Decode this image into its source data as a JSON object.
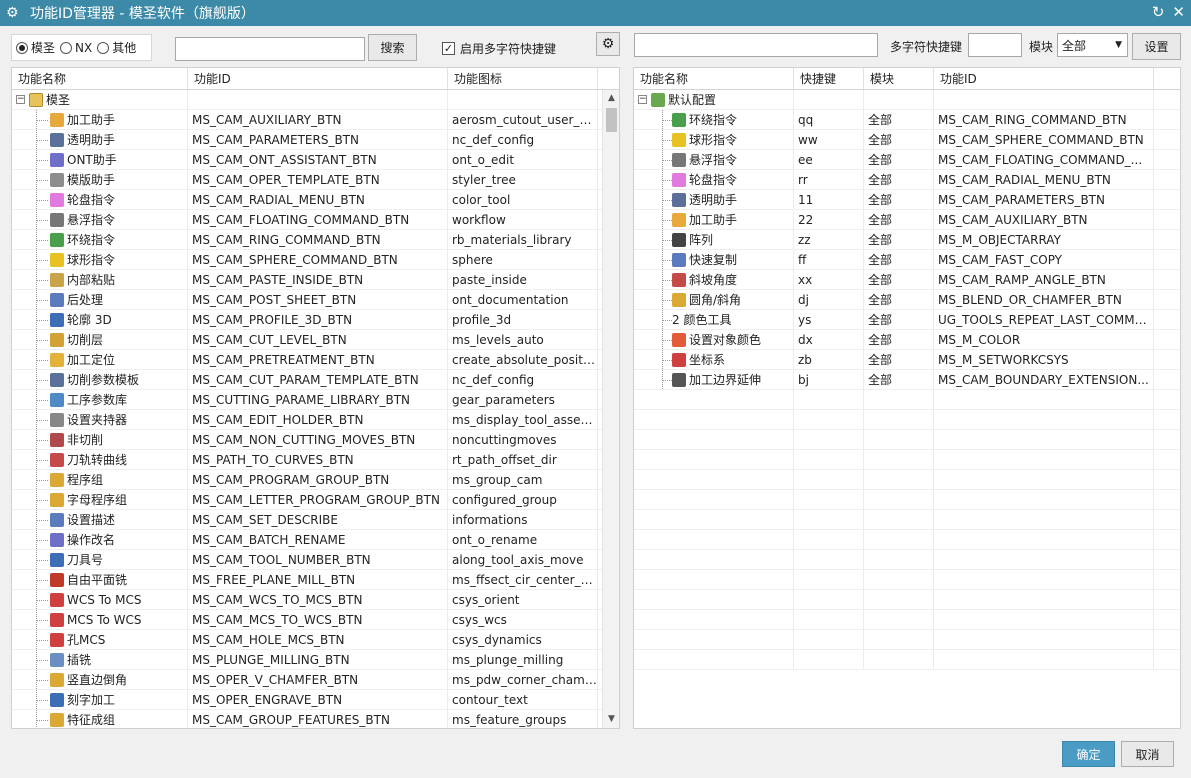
{
  "window": {
    "title": "功能ID管理器 - 模圣软件（旗舰版）"
  },
  "toolbar": {
    "radios": [
      {
        "label": "模圣",
        "checked": true
      },
      {
        "label": "NX",
        "checked": false
      },
      {
        "label": "其他",
        "checked": false
      }
    ],
    "search_value": "",
    "search_label": "搜索",
    "multi_shortcut_label": "启用多字符快捷键",
    "multi_shortcut_checked": true,
    "right_search_value": "",
    "shortcut_field_label": "多字符快捷键",
    "shortcut_value": "",
    "module_label": "模块",
    "module_selected": "全部",
    "set_label": "设置"
  },
  "left_table": {
    "columns": [
      "功能名称",
      "功能ID",
      "功能图标"
    ],
    "root": "模圣",
    "rows": [
      {
        "name": "加工助手",
        "id": "MS_CAM_AUXILIARY_BTN",
        "icon": "aerosm_cutout_user_d...",
        "color": "#e7a93b"
      },
      {
        "name": "透明助手",
        "id": "MS_CAM_PARAMETERS_BTN",
        "icon": "nc_def_config",
        "color": "#5a6f99"
      },
      {
        "name": "ONT助手",
        "id": "MS_CAM_ONT_ASSISTANT_BTN",
        "icon": "ont_o_edit",
        "color": "#6f6fc8"
      },
      {
        "name": "模版助手",
        "id": "MS_CAM_OPER_TEMPLATE_BTN",
        "icon": "styler_tree",
        "color": "#8c8c8c"
      },
      {
        "name": "轮盘指令",
        "id": "MS_CAM_RADIAL_MENU_BTN",
        "icon": "color_tool",
        "color": "#e07adf"
      },
      {
        "name": "悬浮指令",
        "id": "MS_CAM_FLOATING_COMMAND_BTN",
        "icon": "workflow",
        "color": "#777777"
      },
      {
        "name": "环绕指令",
        "id": "MS_CAM_RING_COMMAND_BTN",
        "icon": "rb_materials_library",
        "color": "#4aa04a"
      },
      {
        "name": "球形指令",
        "id": "MS_CAM_SPHERE_COMMAND_BTN",
        "icon": "sphere",
        "color": "#e8c224"
      },
      {
        "name": "内部粘贴",
        "id": "MS_CAM_PASTE_INSIDE_BTN",
        "icon": "paste_inside",
        "color": "#c9a24a"
      },
      {
        "name": "后处理",
        "id": "MS_CAM_POST_SHEET_BTN",
        "icon": "ont_documentation",
        "color": "#5b7bbd"
      },
      {
        "name": "轮廓 3D",
        "id": "MS_CAM_PROFILE_3D_BTN",
        "icon": "profile_3d",
        "color": "#3d6db5"
      },
      {
        "name": "切削层",
        "id": "MS_CAM_CUT_LEVEL_BTN",
        "icon": "ms_levels_auto",
        "color": "#d2a234"
      },
      {
        "name": "加工定位",
        "id": "MS_CAM_PRETREATMENT_BTN",
        "icon": "create_absolute_positi...",
        "color": "#e3b23a"
      },
      {
        "name": "切削参数模板",
        "id": "MS_CAM_CUT_PARAM_TEMPLATE_BTN",
        "icon": "nc_def_config",
        "color": "#5a6f99"
      },
      {
        "name": "工序参数库",
        "id": "MS_CUTTING_PARAME_LIBRARY_BTN",
        "icon": "gear_parameters",
        "color": "#4f8ac7"
      },
      {
        "name": "设置夹持器",
        "id": "MS_CAM_EDIT_HOLDER_BTN",
        "icon": "ms_display_tool_assem...",
        "color": "#888888"
      },
      {
        "name": "非切削",
        "id": "MS_CAM_NON_CUTTING_MOVES_BTN",
        "icon": "noncuttingmoves",
        "color": "#b04a4a"
      },
      {
        "name": "刀轨转曲线",
        "id": "MS_PATH_TO_CURVES_BTN",
        "icon": "rt_path_offset_dir",
        "color": "#c74a4a"
      },
      {
        "name": "程序组",
        "id": "MS_CAM_PROGRAM_GROUP_BTN",
        "icon": "ms_group_cam",
        "color": "#d9a934"
      },
      {
        "name": "字母程序组",
        "id": "MS_CAM_LETTER_PROGRAM_GROUP_BTN",
        "icon": "configured_group",
        "color": "#d9a934"
      },
      {
        "name": "设置描述",
        "id": "MS_CAM_SET_DESCRIBE",
        "icon": "informations",
        "color": "#5b7bbd"
      },
      {
        "name": "操作改名",
        "id": "MS_CAM_BATCH_RENAME",
        "icon": "ont_o_rename",
        "color": "#6f6fc8"
      },
      {
        "name": "刀具号",
        "id": "MS_CAM_TOOL_NUMBER_BTN",
        "icon": "along_tool_axis_move",
        "color": "#3d6db5"
      },
      {
        "name": "自由平面铣",
        "id": "MS_FREE_PLANE_MILL_BTN",
        "icon": "ms_ffsect_cir_center_p...",
        "color": "#c0392b"
      },
      {
        "name": "WCS To MCS",
        "id": "MS_CAM_WCS_TO_MCS_BTN",
        "icon": "csys_orient",
        "color": "#d04040"
      },
      {
        "name": "MCS To WCS",
        "id": "MS_CAM_MCS_TO_WCS_BTN",
        "icon": "csys_wcs",
        "color": "#d04040"
      },
      {
        "name": "孔MCS",
        "id": "MS_CAM_HOLE_MCS_BTN",
        "icon": "csys_dynamics",
        "color": "#d04040"
      },
      {
        "name": "插铣",
        "id": "MS_PLUNGE_MILLING_BTN",
        "icon": "ms_plunge_milling",
        "color": "#6a8fc0"
      },
      {
        "name": "竖直边倒角",
        "id": "MS_OPER_V_CHAMFER_BTN",
        "icon": "ms_pdw_corner_chamfer",
        "color": "#d9a934"
      },
      {
        "name": "刻字加工",
        "id": "MS_OPER_ENGRAVE_BTN",
        "icon": "contour_text",
        "color": "#3d6db5"
      },
      {
        "name": "特征成组",
        "id": "MS_CAM_GROUP_FEATURES_BTN",
        "icon": "ms_feature_groups",
        "color": "#d9a934"
      }
    ]
  },
  "right_table": {
    "columns": [
      "功能名称",
      "快捷键",
      "模块",
      "功能ID"
    ],
    "root": "默认配置",
    "rows": [
      {
        "name": "环绕指令",
        "key": "qq",
        "module": "全部",
        "id": "MS_CAM_RING_COMMAND_BTN",
        "color": "#4aa04a"
      },
      {
        "name": "球形指令",
        "key": "ww",
        "module": "全部",
        "id": "MS_CAM_SPHERE_COMMAND_BTN",
        "color": "#e8c224"
      },
      {
        "name": "悬浮指令",
        "key": "ee",
        "module": "全部",
        "id": "MS_CAM_FLOATING_COMMAND_...",
        "color": "#777777"
      },
      {
        "name": "轮盘指令",
        "key": "rr",
        "module": "全部",
        "id": "MS_CAM_RADIAL_MENU_BTN",
        "color": "#e07adf"
      },
      {
        "name": "透明助手",
        "key": "11",
        "module": "全部",
        "id": "MS_CAM_PARAMETERS_BTN",
        "color": "#5a6f99"
      },
      {
        "name": "加工助手",
        "key": "22",
        "module": "全部",
        "id": "MS_CAM_AUXILIARY_BTN",
        "color": "#e7a93b"
      },
      {
        "name": "阵列",
        "key": "zz",
        "module": "全部",
        "id": "MS_M_OBJECTARRAY",
        "color": "#444444"
      },
      {
        "name": "快速复制",
        "key": "ff",
        "module": "全部",
        "id": "MS_CAM_FAST_COPY",
        "color": "#5b7bbd"
      },
      {
        "name": "斜坡角度",
        "key": "xx",
        "module": "全部",
        "id": "MS_CAM_RAMP_ANGLE_BTN",
        "color": "#c74a4a"
      },
      {
        "name": "圆角/斜角",
        "key": "dj",
        "module": "全部",
        "id": "MS_BLEND_OR_CHAMFER_BTN",
        "color": "#d9a934"
      },
      {
        "name": "2 颜色工具",
        "key": "ys",
        "module": "全部",
        "id": "UG_TOOLS_REPEAT_LAST_COMMA...",
        "color": ""
      },
      {
        "name": "设置对象颜色",
        "key": "dx",
        "module": "全部",
        "id": "MS_M_COLOR",
        "color": "#e25c3a"
      },
      {
        "name": "坐标系",
        "key": "zb",
        "module": "全部",
        "id": "MS_M_SETWORKCSYS",
        "color": "#d04040"
      },
      {
        "name": "加工边界延伸",
        "key": "bj",
        "module": "全部",
        "id": "MS_CAM_BOUNDARY_EXTENSION...",
        "color": "#555555"
      }
    ]
  },
  "footer": {
    "ok_label": "确定",
    "cancel_label": "取消"
  }
}
